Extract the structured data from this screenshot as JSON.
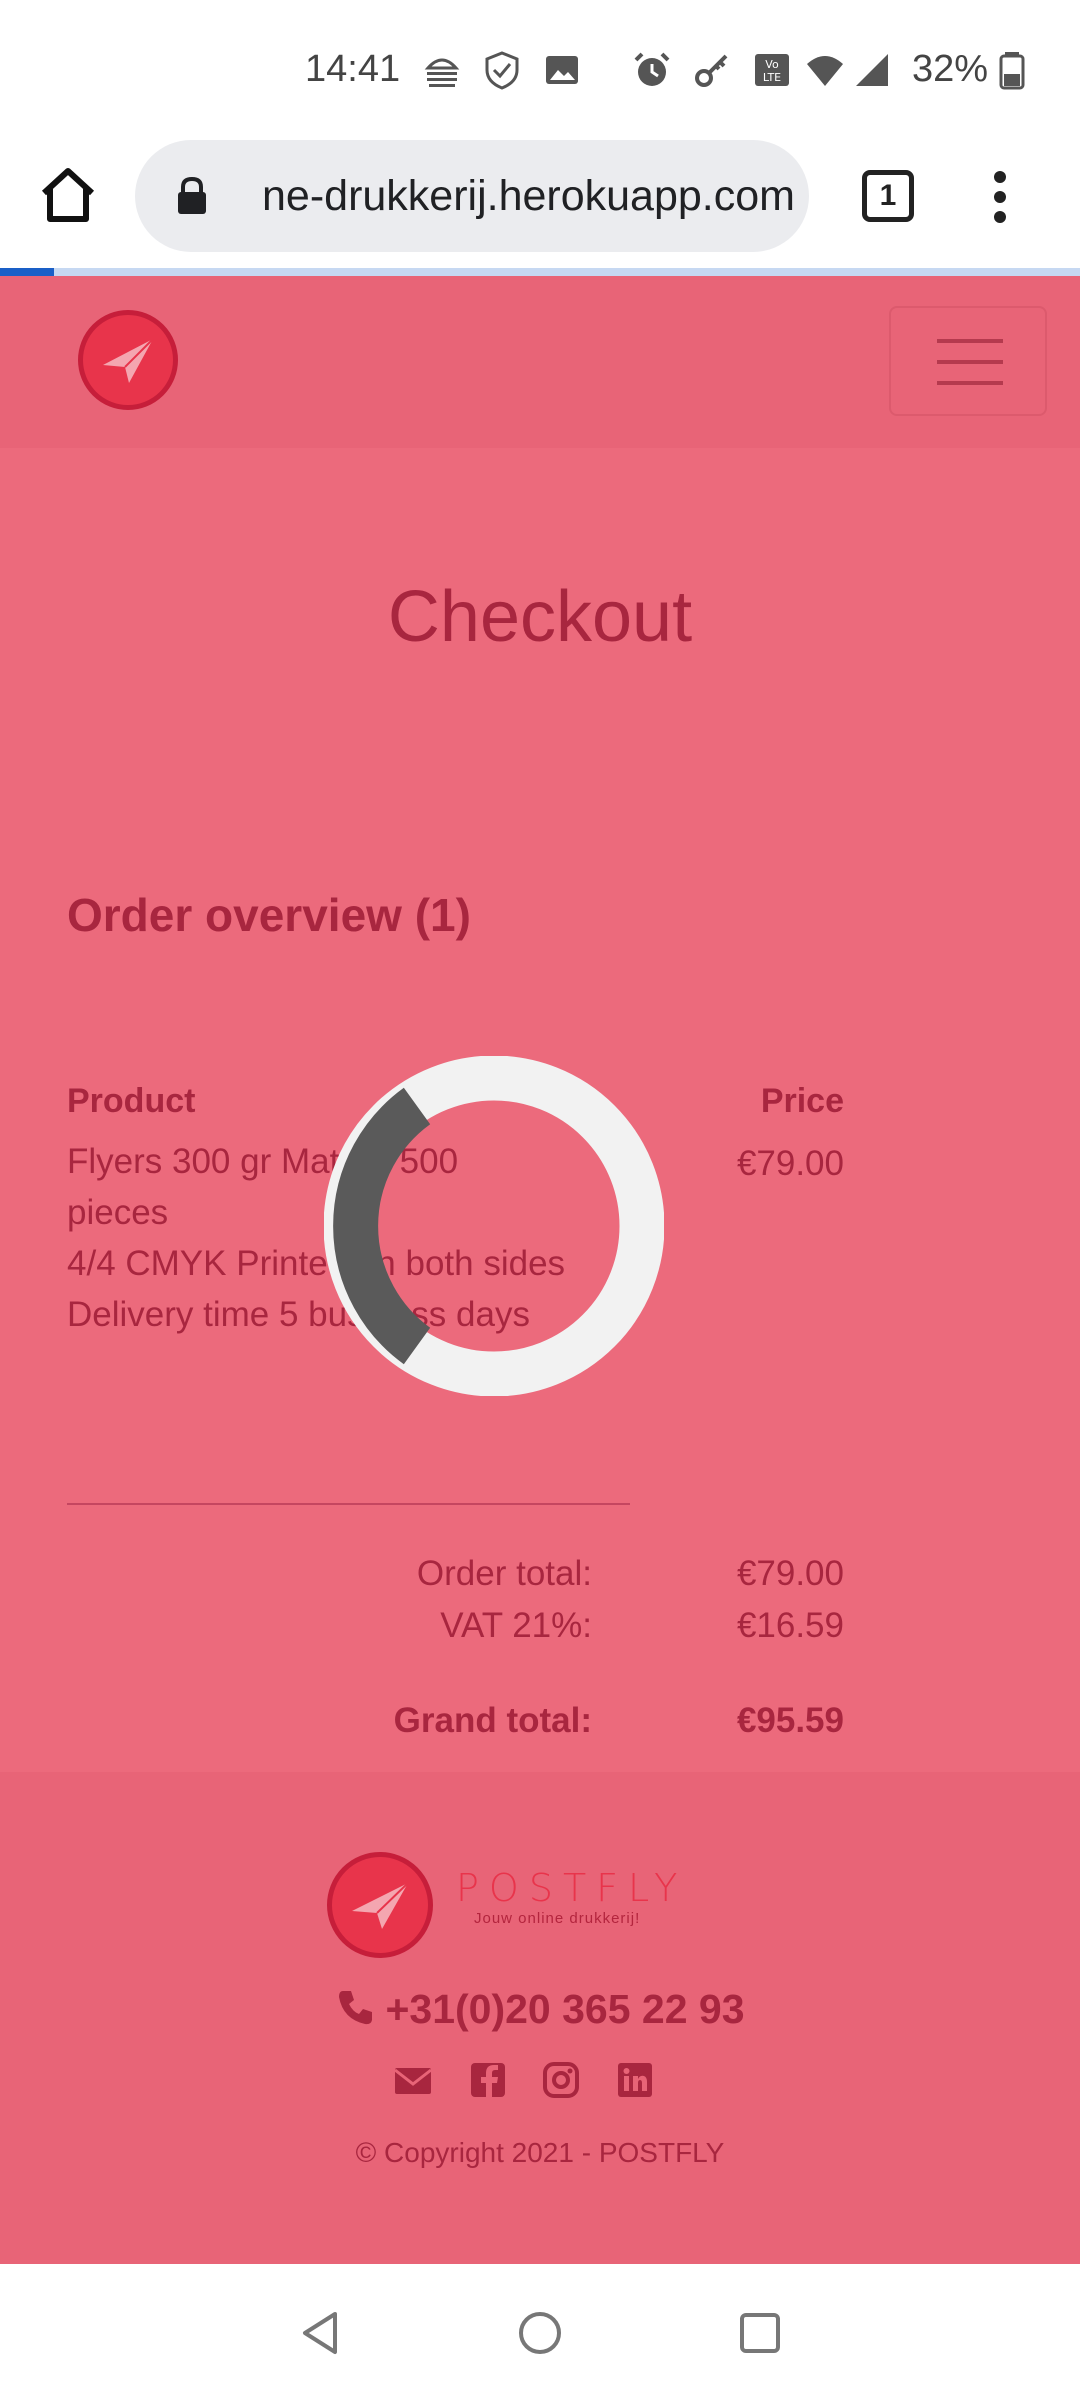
{
  "status_bar": {
    "time": "14:41",
    "battery": "32%",
    "icons": [
      "burger-app-icon",
      "shield-icon",
      "image-icon",
      "alarm-icon",
      "key-icon",
      "volte-icon",
      "wifi-icon",
      "signal-icon",
      "battery-icon"
    ]
  },
  "browser": {
    "url": "ne-drukkerij.herokuapp.com",
    "tab_count": "1",
    "load_progress_percent": 5
  },
  "page": {
    "title": "Checkout",
    "order_overview": "Order overview (1)",
    "table": {
      "headers": {
        "product": "Product",
        "price": "Price"
      },
      "rows": [
        {
          "lines": [
            "Flyers 300 gr Mat A5 500 pieces",
            "4/4 CMYK Printed on both sides",
            "Delivery time 5 business days"
          ],
          "price": "€79.00"
        }
      ]
    },
    "summary": {
      "order_total_label": "Order total:",
      "order_total": "€79.00",
      "vat_label": "VAT 21%:",
      "vat": "€16.59",
      "grand_total_label": "Grand total:",
      "grand_total": "€95.59"
    }
  },
  "footer": {
    "brand": "POSTFLY",
    "tagline": "Jouw online drukkerij!",
    "phone": "+31(0)20 365 22 93",
    "social": [
      "envelope-icon",
      "facebook-icon",
      "instagram-icon",
      "linkedin-icon"
    ],
    "copyright": "© Copyright 2021 - POSTFLY"
  },
  "colors": {
    "page_bg": "#ec6a7c",
    "header_bg": "#e86477",
    "text": "#a8263f",
    "brand_red": "#e8344b"
  }
}
